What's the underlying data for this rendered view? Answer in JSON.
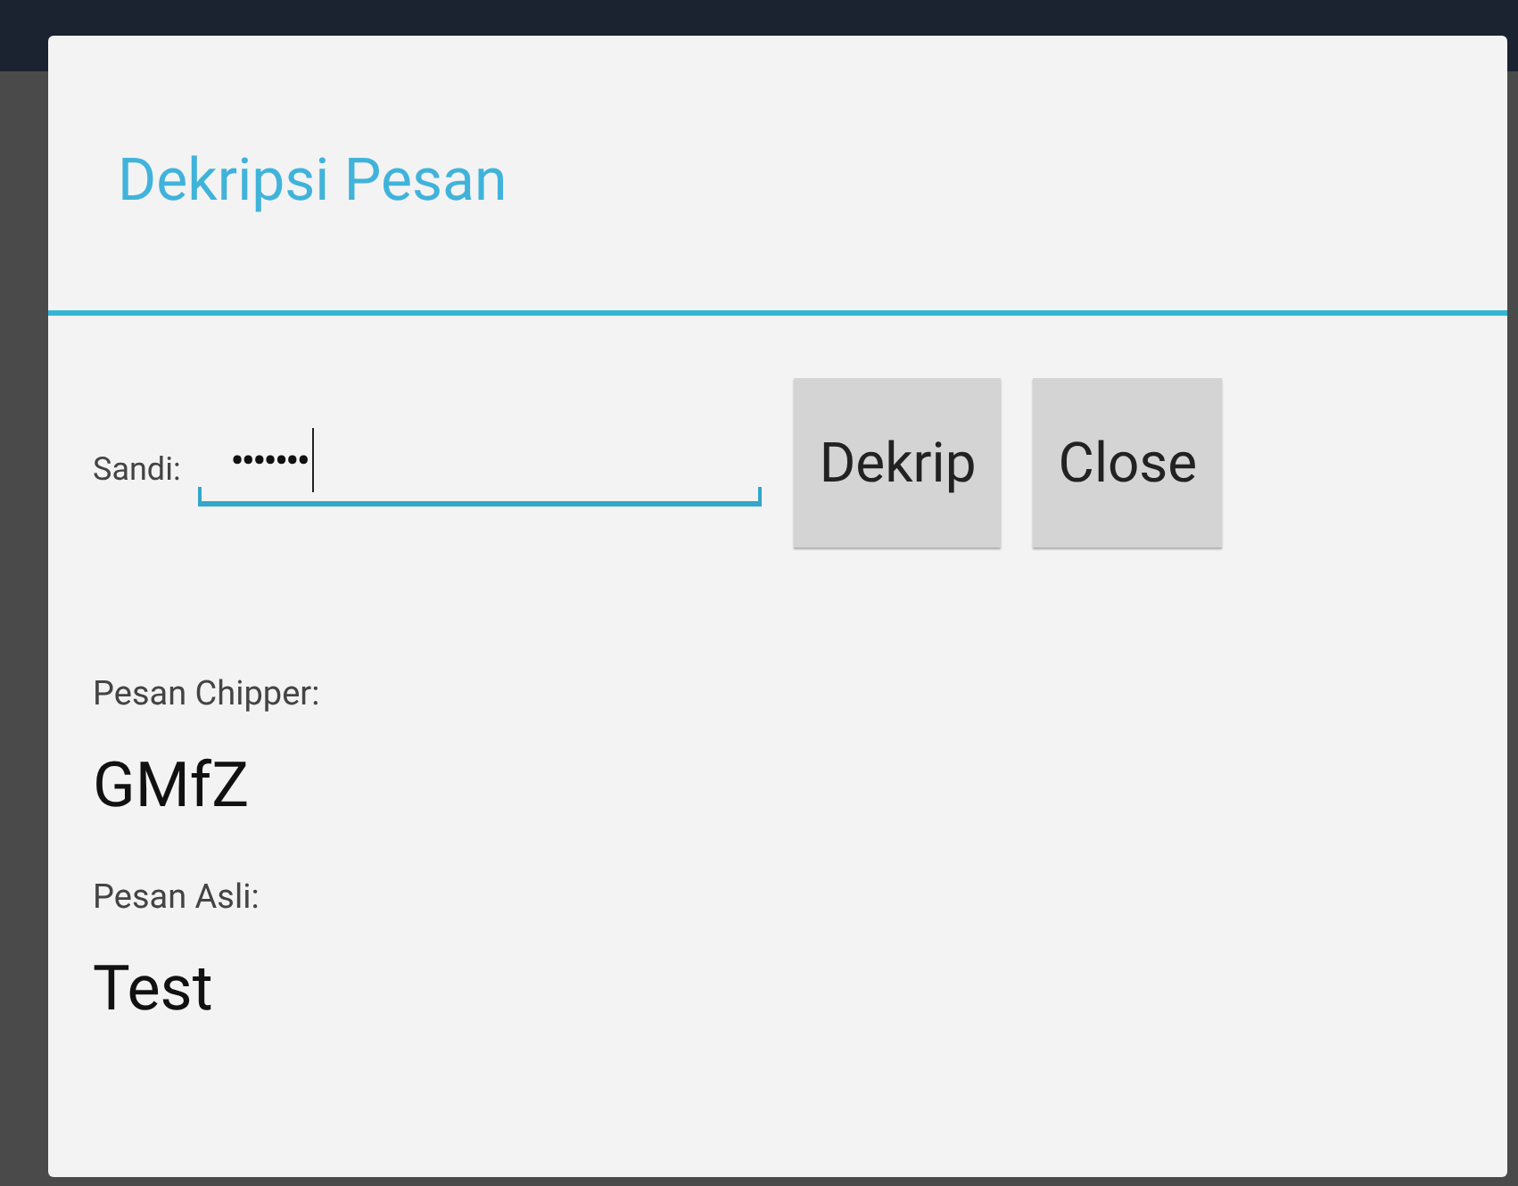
{
  "dialog": {
    "title": "Dekripsi Pesan"
  },
  "password": {
    "label": "Sandi:",
    "value": "•••••••",
    "focused": true
  },
  "buttons": [
    "Dekrip",
    "Close"
  ],
  "outputs": [
    {
      "label": "Pesan Chipper:",
      "value": "GMfZ"
    },
    {
      "label": "Pesan Asli:",
      "value": "Test"
    }
  ]
}
